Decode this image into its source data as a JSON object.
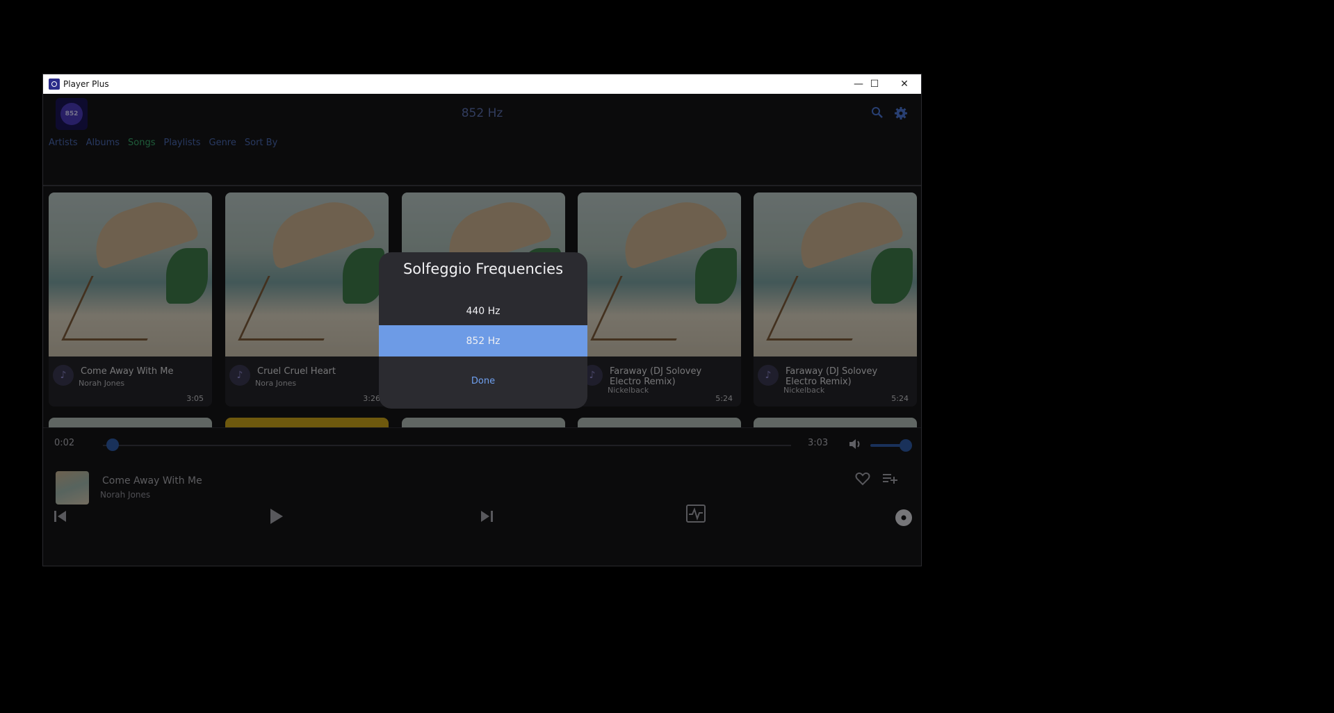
{
  "window": {
    "title": "Player Plus",
    "minimize": "—",
    "maximize": "☐",
    "close": "✕"
  },
  "header": {
    "logo_text": "852",
    "title": "852 Hz",
    "nav": [
      {
        "label": "Artists",
        "active": false
      },
      {
        "label": "Albums",
        "active": false
      },
      {
        "label": "Songs",
        "active": true
      },
      {
        "label": "Playlists",
        "active": false
      },
      {
        "label": "Genre",
        "active": false
      },
      {
        "label": "Sort By",
        "active": false
      }
    ]
  },
  "songs": [
    {
      "title": "Come Away With Me",
      "artist": "Norah Jones",
      "duration": "3:05"
    },
    {
      "title": "Cruel Cruel Heart",
      "artist": "Nora Jones",
      "duration": "3:26"
    },
    {
      "title": "",
      "artist": "",
      "duration": ""
    },
    {
      "title": "Faraway (DJ Solovey Electro Remix)",
      "artist": "Nickelback",
      "duration": "5:24"
    },
    {
      "title": "Faraway (DJ Solovey Electro Remix)",
      "artist": "Nickelback",
      "duration": "5:24"
    }
  ],
  "player": {
    "elapsed": "0:02",
    "total": "3:03",
    "progress": 0.01,
    "volume": 0.8,
    "now_playing_title": "Come Away With Me",
    "now_playing_artist": "Norah Jones"
  },
  "dialog": {
    "title": "Solfeggio Frequencies",
    "options": [
      "440 Hz",
      "852 Hz"
    ],
    "selected": "852 Hz",
    "done_label": "Done"
  },
  "colors": {
    "accent": "#6d9be6",
    "nav_active": "#39a86a",
    "nav": "#4a68b0"
  }
}
